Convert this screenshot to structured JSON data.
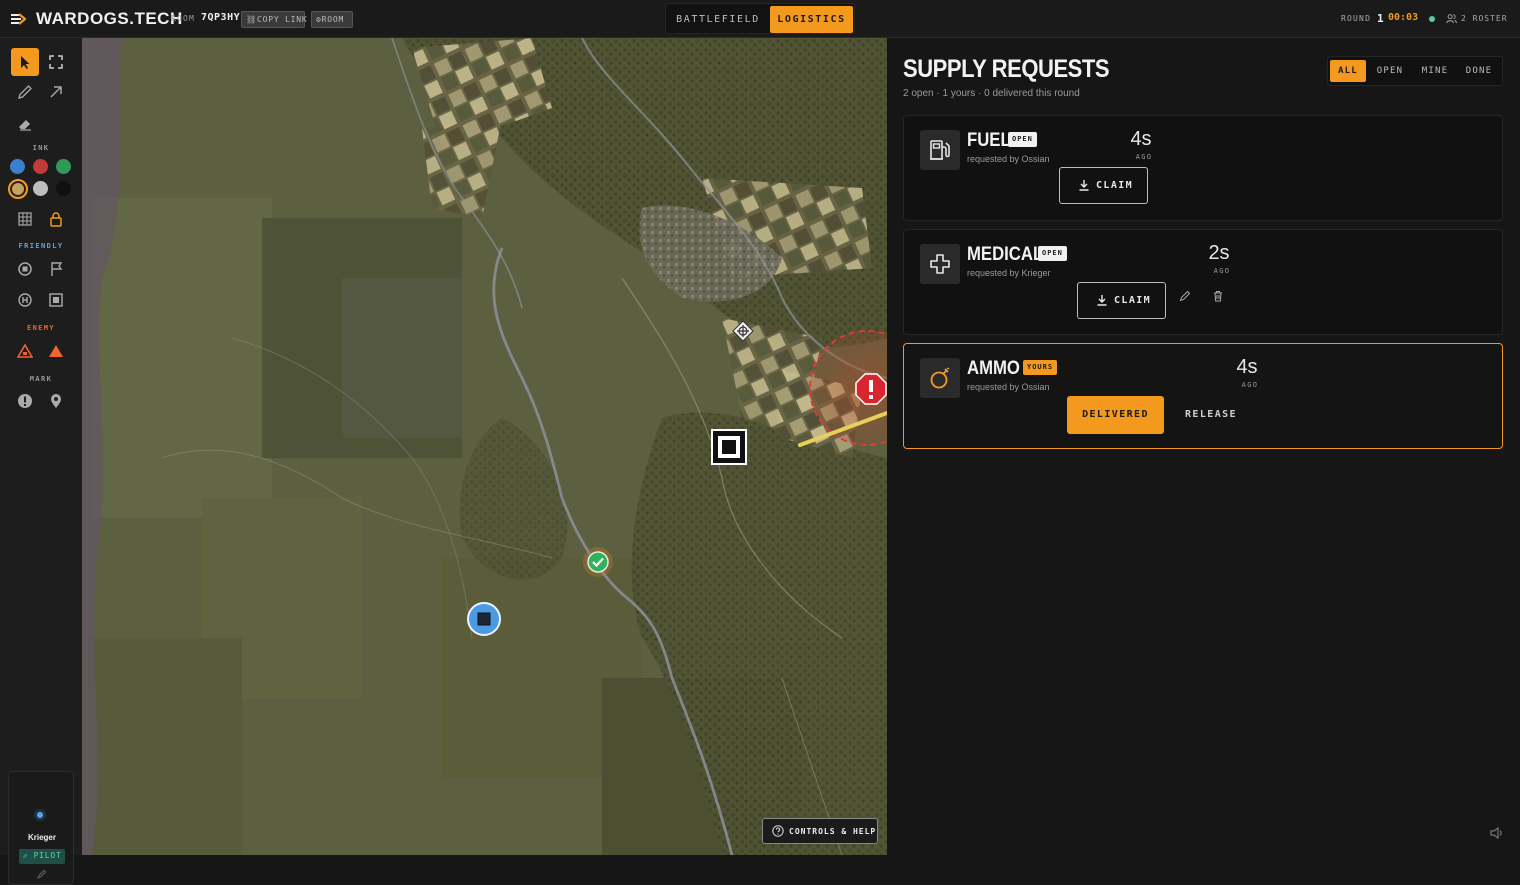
{
  "header": {
    "brand": "WARDOGS.TECH",
    "room_label": "ROOM",
    "room_code": "7QP3HY",
    "copy_link_label": "COPY LINK",
    "room_button_label": "ROOM",
    "tabs": [
      {
        "label": "BATTLEFIELD",
        "active": false
      },
      {
        "label": "LOGISTICS",
        "active": true
      }
    ],
    "round_label": "ROUND",
    "round_number": "1",
    "timer": "00:03",
    "roster_label": "2 ROSTER",
    "icons": [
      "logo-arrow-icon",
      "link-icon",
      "gear-icon",
      "status-dot",
      "users-icon"
    ]
  },
  "toolbar": {
    "ink_label": "INK",
    "friendly_label": "FRIENDLY",
    "enemy_label": "ENEMY",
    "mark_label": "MARK",
    "ink_colors": [
      "#3b7fd0",
      "#c23a3a",
      "#2f9a58",
      "#c7a35e",
      "#bdbdbd",
      "#101010"
    ],
    "selected_ink": "#c7a35e",
    "tools": [
      "cursor-icon",
      "fullscreen-icon",
      "pencil-icon",
      "arrow-icon",
      "eraser-icon",
      "grid-icon",
      "lock-icon",
      "friendly-unit-icon",
      "flag-icon",
      "hq-icon",
      "base-icon",
      "enemy-triangle-outline-icon",
      "enemy-triangle-solid-icon",
      "alert-icon",
      "pin-icon"
    ],
    "user": {
      "name": "Krieger",
      "role": "PILOT"
    }
  },
  "map": {
    "controls_label": "CONTROLS & HELP",
    "markers": [
      "objective-square-icon",
      "waypoint-diamond-icon",
      "enemy-alert-icon",
      "friendly-check-icon",
      "friendly-unit-icon"
    ]
  },
  "logistics": {
    "title": "SUPPLY REQUESTS",
    "subtitle": "2 open · 1 yours · 0 delivered this round",
    "filters": [
      {
        "label": "ALL",
        "active": true
      },
      {
        "label": "OPEN",
        "active": false
      },
      {
        "label": "MINE",
        "active": false
      },
      {
        "label": "DONE",
        "active": false
      }
    ],
    "requests": [
      {
        "title": "FUEL",
        "badge": "OPEN",
        "requested_by": "requested by Ossian",
        "age": "4s",
        "ago": "AGO",
        "action": "CLAIM",
        "icon": "fuel-pump-icon"
      },
      {
        "title": "MEDICAL",
        "badge": "OPEN",
        "requested_by": "requested by Krieger",
        "age": "2s",
        "ago": "AGO",
        "action": "CLAIM",
        "icon": "medical-cross-icon"
      },
      {
        "title": "AMMO",
        "badge": "YOURS",
        "requested_by": "requested by Ossian",
        "age": "4s",
        "ago": "AGO",
        "action": "DELIVERED",
        "secondary_action": "RELEASE",
        "icon": "grenade-icon"
      }
    ]
  },
  "colors": {
    "accent": "#f39a1e",
    "friendly": "#5da4e6",
    "enemy": "#f0622f",
    "pilot": "#5ed3b0"
  }
}
